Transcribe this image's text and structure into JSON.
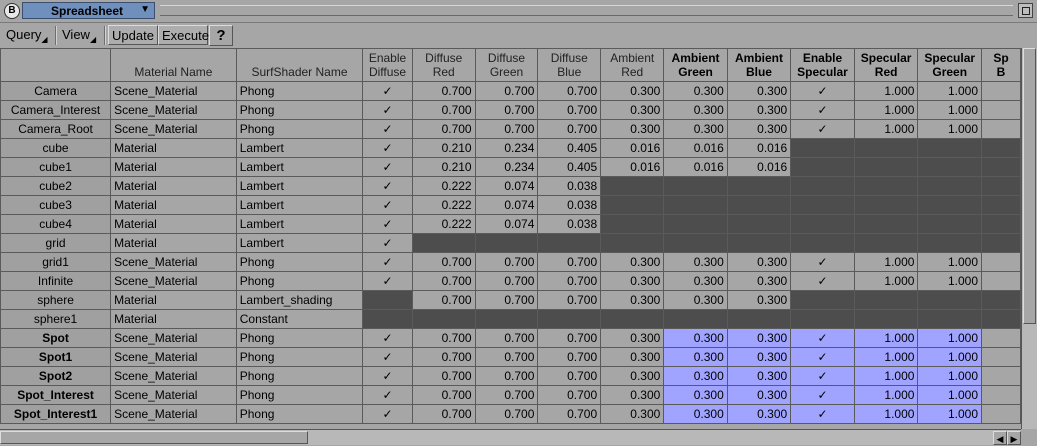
{
  "window": {
    "title": "Spreadsheet",
    "app_icon": "B"
  },
  "toolbar": {
    "query": "Query",
    "view": "View",
    "update": "Update",
    "execute": "Execute",
    "help": "?"
  },
  "columns": [
    {
      "label": "Material Name",
      "bold": false
    },
    {
      "label": "SurfShader Name",
      "bold": false
    },
    {
      "label": "Enable\nDiffuse",
      "bold": false
    },
    {
      "label": "Diffuse\nRed",
      "bold": false
    },
    {
      "label": "Diffuse\nGreen",
      "bold": false
    },
    {
      "label": "Diffuse\nBlue",
      "bold": false
    },
    {
      "label": "Ambient\nRed",
      "bold": false
    },
    {
      "label": "Ambient\nGreen",
      "bold": true
    },
    {
      "label": "Ambient\nBlue",
      "bold": true
    },
    {
      "label": "Enable\nSpecular",
      "bold": true
    },
    {
      "label": "Specular\nRed",
      "bold": true
    },
    {
      "label": "Specular\nGreen",
      "bold": true
    },
    {
      "label": "Sp\nB",
      "bold": true
    }
  ],
  "check_glyph": "✓",
  "rows": [
    {
      "name": "Camera",
      "bold": false,
      "material": "Scene_Material",
      "shader": "Phong",
      "enable_diffuse": "check",
      "diffuse": [
        "0.700",
        "0.700",
        "0.700"
      ],
      "ambient": [
        "0.300",
        "0.300",
        "0.300"
      ],
      "enable_specular": "check",
      "specular": [
        "1.000",
        "1.000"
      ],
      "selected": false
    },
    {
      "name": "Camera_Interest",
      "bold": false,
      "material": "Scene_Material",
      "shader": "Phong",
      "enable_diffuse": "check",
      "diffuse": [
        "0.700",
        "0.700",
        "0.700"
      ],
      "ambient": [
        "0.300",
        "0.300",
        "0.300"
      ],
      "enable_specular": "check",
      "specular": [
        "1.000",
        "1.000"
      ],
      "selected": false
    },
    {
      "name": "Camera_Root",
      "bold": false,
      "material": "Scene_Material",
      "shader": "Phong",
      "enable_diffuse": "check",
      "diffuse": [
        "0.700",
        "0.700",
        "0.700"
      ],
      "ambient": [
        "0.300",
        "0.300",
        "0.300"
      ],
      "enable_specular": "check",
      "specular": [
        "1.000",
        "1.000"
      ],
      "selected": false
    },
    {
      "name": "cube",
      "bold": false,
      "material": "Material",
      "shader": "Lambert",
      "enable_diffuse": "check",
      "diffuse": [
        "0.210",
        "0.234",
        "0.405"
      ],
      "ambient": [
        "0.016",
        "0.016",
        "0.016"
      ],
      "enable_specular": null,
      "specular": null,
      "selected": false
    },
    {
      "name": "cube1",
      "bold": false,
      "material": "Material",
      "shader": "Lambert",
      "enable_diffuse": "check",
      "diffuse": [
        "0.210",
        "0.234",
        "0.405"
      ],
      "ambient": [
        "0.016",
        "0.016",
        "0.016"
      ],
      "enable_specular": null,
      "specular": null,
      "selected": false
    },
    {
      "name": "cube2",
      "bold": false,
      "material": "Material",
      "shader": "Lambert",
      "enable_diffuse": "check",
      "diffuse": [
        "0.222",
        "0.074",
        "0.038"
      ],
      "ambient": null,
      "enable_specular": null,
      "specular": null,
      "selected": false
    },
    {
      "name": "cube3",
      "bold": false,
      "material": "Material",
      "shader": "Lambert",
      "enable_diffuse": "check",
      "diffuse": [
        "0.222",
        "0.074",
        "0.038"
      ],
      "ambient": null,
      "enable_specular": null,
      "specular": null,
      "selected": false
    },
    {
      "name": "cube4",
      "bold": false,
      "material": "Material",
      "shader": "Lambert",
      "enable_diffuse": "check",
      "diffuse": [
        "0.222",
        "0.074",
        "0.038"
      ],
      "ambient": null,
      "enable_specular": null,
      "specular": null,
      "selected": false
    },
    {
      "name": "grid",
      "bold": false,
      "material": "Material",
      "shader": "Lambert",
      "enable_diffuse": "check",
      "diffuse": null,
      "ambient": null,
      "enable_specular": null,
      "specular": null,
      "selected": false
    },
    {
      "name": "grid1",
      "bold": false,
      "material": "Scene_Material",
      "shader": "Phong",
      "enable_diffuse": "check",
      "diffuse": [
        "0.700",
        "0.700",
        "0.700"
      ],
      "ambient": [
        "0.300",
        "0.300",
        "0.300"
      ],
      "enable_specular": "check",
      "specular": [
        "1.000",
        "1.000"
      ],
      "selected": false
    },
    {
      "name": "Infinite",
      "bold": false,
      "material": "Scene_Material",
      "shader": "Phong",
      "enable_diffuse": "check",
      "diffuse": [
        "0.700",
        "0.700",
        "0.700"
      ],
      "ambient": [
        "0.300",
        "0.300",
        "0.300"
      ],
      "enable_specular": "check",
      "specular": [
        "1.000",
        "1.000"
      ],
      "selected": false
    },
    {
      "name": "sphere",
      "bold": false,
      "material": "Material",
      "shader": "Lambert_shading",
      "enable_diffuse": null,
      "diffuse": [
        "0.700",
        "0.700",
        "0.700"
      ],
      "ambient": [
        "0.300",
        "0.300",
        "0.300"
      ],
      "enable_specular": null,
      "specular": null,
      "selected": false
    },
    {
      "name": "sphere1",
      "bold": false,
      "material": "Material",
      "shader": "Constant",
      "enable_diffuse": null,
      "diffuse": null,
      "ambient": null,
      "enable_specular": null,
      "specular": null,
      "selected": false
    },
    {
      "name": "Spot",
      "bold": true,
      "material": "Scene_Material",
      "shader": "Phong",
      "enable_diffuse": "check",
      "diffuse": [
        "0.700",
        "0.700",
        "0.700"
      ],
      "ambient": [
        "0.300",
        "0.300",
        "0.300"
      ],
      "enable_specular": "check",
      "specular": [
        "1.000",
        "1.000"
      ],
      "selected": true
    },
    {
      "name": "Spot1",
      "bold": true,
      "material": "Scene_Material",
      "shader": "Phong",
      "enable_diffuse": "check",
      "diffuse": [
        "0.700",
        "0.700",
        "0.700"
      ],
      "ambient": [
        "0.300",
        "0.300",
        "0.300"
      ],
      "enable_specular": "check",
      "specular": [
        "1.000",
        "1.000"
      ],
      "selected": true
    },
    {
      "name": "Spot2",
      "bold": true,
      "material": "Scene_Material",
      "shader": "Phong",
      "enable_diffuse": "check",
      "diffuse": [
        "0.700",
        "0.700",
        "0.700"
      ],
      "ambient": [
        "0.300",
        "0.300",
        "0.300"
      ],
      "enable_specular": "check",
      "specular": [
        "1.000",
        "1.000"
      ],
      "selected": true
    },
    {
      "name": "Spot_Interest",
      "bold": true,
      "material": "Scene_Material",
      "shader": "Phong",
      "enable_diffuse": "check",
      "diffuse": [
        "0.700",
        "0.700",
        "0.700"
      ],
      "ambient": [
        "0.300",
        "0.300",
        "0.300"
      ],
      "enable_specular": "check",
      "specular": [
        "1.000",
        "1.000"
      ],
      "selected": true
    },
    {
      "name": "Spot_Interest1",
      "bold": true,
      "material": "Scene_Material",
      "shader": "Phong",
      "enable_diffuse": "check",
      "diffuse": [
        "0.700",
        "0.700",
        "0.700"
      ],
      "ambient": [
        "0.300",
        "0.300",
        "0.300"
      ],
      "enable_specular": "check",
      "specular": [
        "1.000",
        "1.000"
      ],
      "selected": true
    }
  ],
  "colors": {
    "selection": "#a0a4ff",
    "inactive_cell": "#4d4d4d",
    "background": "#a6a6a6",
    "title_tab": "#6f8fbd"
  }
}
